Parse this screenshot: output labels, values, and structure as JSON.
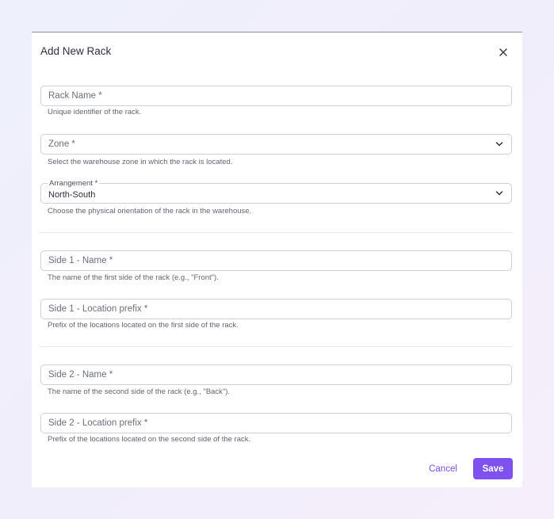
{
  "dialog": {
    "title": "Add New Rack",
    "close_icon": "close-icon"
  },
  "fields": {
    "rack_name": {
      "placeholder": "Rack Name *",
      "helper": "Unique identifier of the rack."
    },
    "zone": {
      "placeholder": "Zone *",
      "helper": "Select the warehouse zone in which the rack is located.",
      "icon": "chevron-down-icon"
    },
    "arrangement": {
      "label": "Arrangement *",
      "value": "North-South",
      "helper": "Choose the physical orientation of the rack in the warehouse.",
      "icon": "chevron-down-icon"
    },
    "side1_name": {
      "placeholder": "Side 1 - Name *",
      "helper": "The name of the first side of the rack (e.g., \"Front\")."
    },
    "side1_prefix": {
      "placeholder": "Side 1 - Location prefix *",
      "helper": "Prefix of the locations located on the first side of the rack."
    },
    "side2_name": {
      "placeholder": "Side 2 - Name *",
      "helper": "The name of the second side of the rack (e.g., \"Back\")."
    },
    "side2_prefix": {
      "placeholder": "Side 2 - Location prefix *",
      "helper": "Prefix of the locations located on the second side of the rack."
    }
  },
  "actions": {
    "cancel_label": "Cancel",
    "save_label": "Save"
  },
  "colors": {
    "accent": "#7f52f0",
    "accent_text": "#7a4df0",
    "border": "#cdd0d6",
    "helper_text": "#61656f",
    "title_text": "#2c2f3a"
  }
}
